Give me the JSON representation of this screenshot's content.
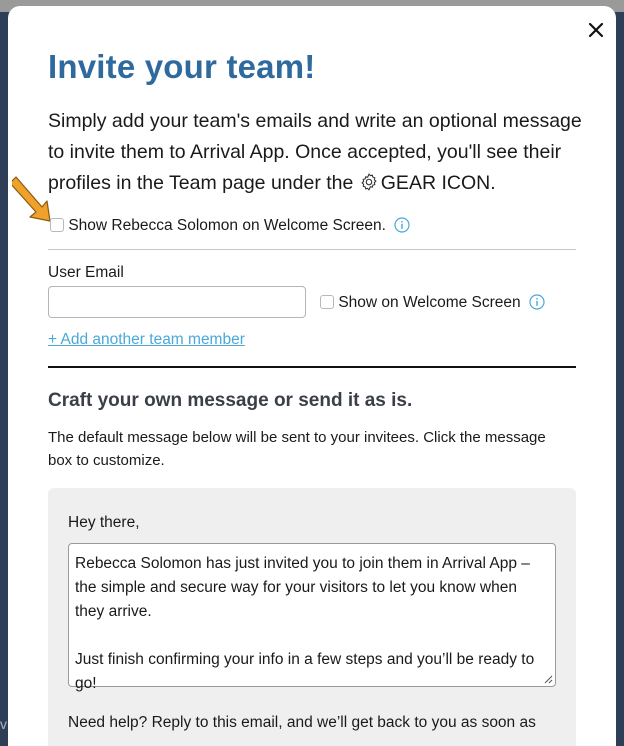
{
  "backdrop": {
    "partial_text": "v"
  },
  "modal": {
    "close_label": "✕",
    "title": "Invite your team!",
    "intro": {
      "before_icon": "Simply add your team's emails and write an optional message to invite them to Arrival App. Once accepted, you'll see their profiles in the Team page under the ",
      "icon": "gear-icon",
      "after_icon": "GEAR ICON."
    },
    "welcome_checkbox": {
      "label": "Show Rebecca Solomon on Welcome Screen.",
      "checked": false,
      "info_icon": "info-icon"
    },
    "email_section": {
      "label": "User Email",
      "value": "",
      "placeholder": "",
      "show_checkbox": {
        "label": "Show on Welcome Screen",
        "checked": false,
        "info_icon": "info-icon"
      },
      "add_link": "+ Add another team member"
    },
    "message_section": {
      "title": "Craft your own message or send it as is.",
      "description": "The default message below will be sent to your invitees. Click the message box to customize.",
      "greeting": "Hey there,",
      "body_para1": "Rebecca Solomon has just invited you to join them in Arrival App – the simple and secure way for your visitors to let you know when they arrive.",
      "body_para2": "Just finish confirming your info in a few steps and you’ll be ready to go!",
      "help": "Need help?  Reply to this email, and we’ll get back to you as soon as"
    }
  },
  "colors": {
    "title": "#2f6a9e",
    "link": "#49a9d8",
    "arrow": "#f0a12c",
    "backdrop": "#2e3e57",
    "message_bg": "#efefef"
  }
}
